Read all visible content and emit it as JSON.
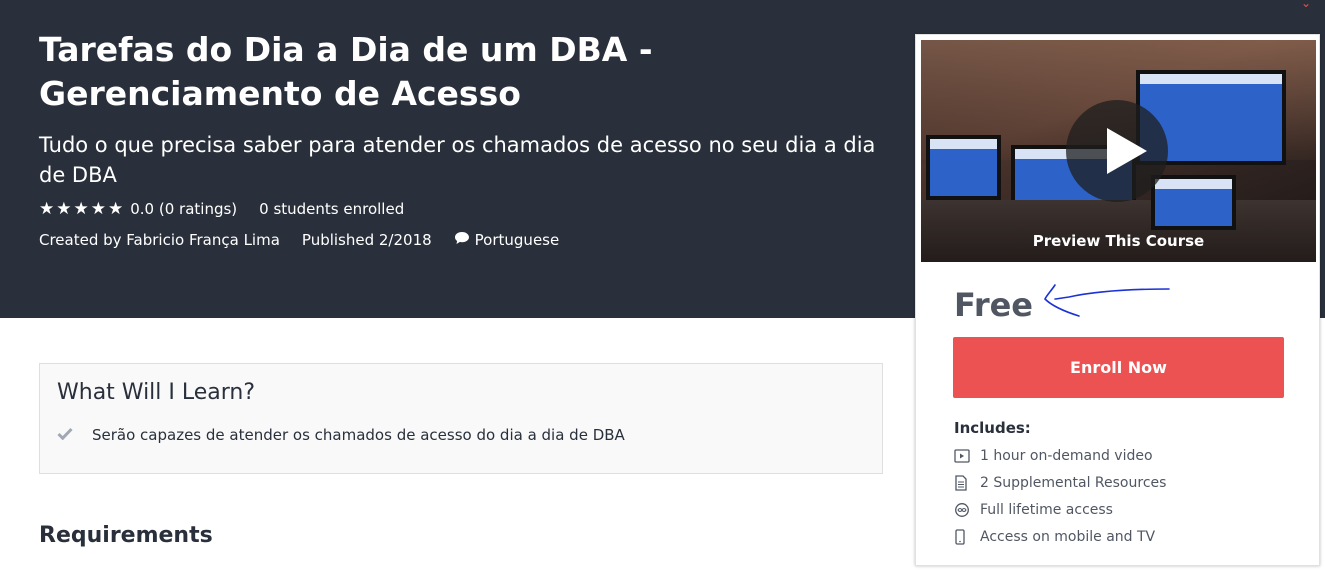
{
  "course": {
    "title_line1": "Tarefas do Dia a Dia de um DBA -",
    "title_line2": "Gerenciamento de Acesso",
    "subtitle": "Tudo o que precisa saber para atender os chamados de acesso no seu dia a dia de DBA",
    "rating_text": "0.0 (0 ratings)",
    "enrolled_text": "0 students enrolled",
    "rating_stars": 5,
    "created_by": "Created by Fabricio França Lima",
    "published": "Published 2/2018",
    "language": "Portuguese"
  },
  "learn": {
    "title": "What Will I Learn?",
    "items": [
      "Serão capazes de atender os chamados de acesso do dia a dia de DBA"
    ]
  },
  "requirements": {
    "title": "Requirements"
  },
  "sidebar": {
    "preview_label": "Preview This Course",
    "price": "Free",
    "enroll_label": "Enroll Now",
    "includes_title": "Includes:",
    "includes": [
      {
        "icon": "video-icon",
        "label": "1 hour on-demand video"
      },
      {
        "icon": "document-icon",
        "label": "2 Supplemental Resources"
      },
      {
        "icon": "lifetime-icon",
        "label": "Full lifetime access"
      },
      {
        "icon": "mobile-icon",
        "label": "Access on mobile and TV"
      }
    ]
  },
  "colors": {
    "hero_bg": "#29303b",
    "accent": "#ec5252",
    "annotation": "#1a32d6"
  },
  "icons": {
    "star": "star-icon",
    "language": "speech-bubble-icon",
    "check": "checkmark-icon",
    "play": "play-icon"
  }
}
